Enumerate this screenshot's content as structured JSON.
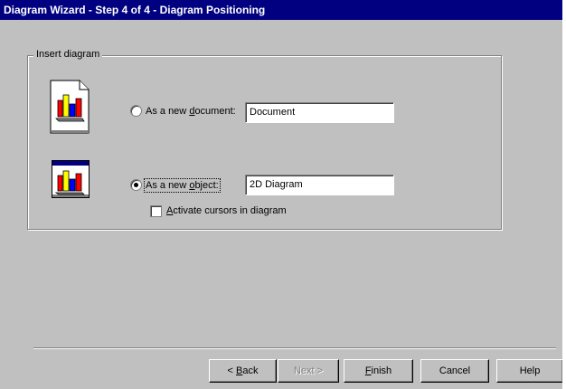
{
  "window": {
    "title": "Diagram Wizard  - Step 4 of 4 - Diagram Positioning"
  },
  "group": {
    "label": "Insert diagram"
  },
  "options": {
    "new_document": {
      "label_before": "As a new ",
      "label_access": "d",
      "label_after": "ocument:",
      "selected": false,
      "field_value": "Document",
      "icon": "chart-document-icon"
    },
    "new_object": {
      "label_before": "As a new ",
      "label_access": "o",
      "label_after": "bject:",
      "selected": true,
      "field_value": "2D Diagram",
      "icon": "chart-window-icon"
    },
    "activate_cursors": {
      "label_access": "A",
      "label_after": "ctivate cursors in diagram",
      "checked": false
    }
  },
  "buttons": {
    "back_prefix": "< ",
    "back_access": "B",
    "back_after": "ack",
    "next_label": "Next >",
    "finish_access": "F",
    "finish_after": "inish",
    "cancel": "Cancel",
    "help": "Help"
  },
  "colors": {
    "title_bar": "#000080",
    "dialog_face": "#c0c0c0",
    "bar_red": "#ff0000",
    "bar_yellow": "#ffff00",
    "bar_blue": "#0000ff"
  }
}
